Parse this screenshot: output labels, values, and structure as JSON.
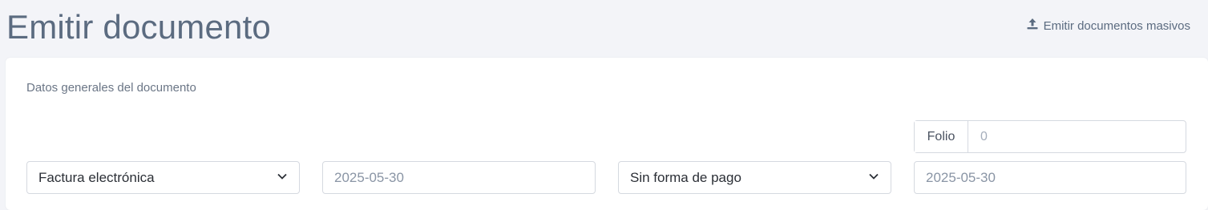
{
  "header": {
    "title": "Emitir documento",
    "bulk_link_label": "Emitir documentos masivos",
    "bulk_icon": "upload-icon"
  },
  "section": {
    "title": "Datos generales del documento"
  },
  "fields": {
    "document_type": "Factura electrónica",
    "issue_date": "2025-05-30",
    "payment_method": "Sin forma de pago",
    "due_date": "2025-05-30",
    "folio_label": "Folio",
    "folio_value": "0"
  },
  "colors": {
    "background": "#f3f4f8",
    "title": "#5b6b80",
    "card": "#ffffff",
    "border": "#d5d9e0"
  }
}
